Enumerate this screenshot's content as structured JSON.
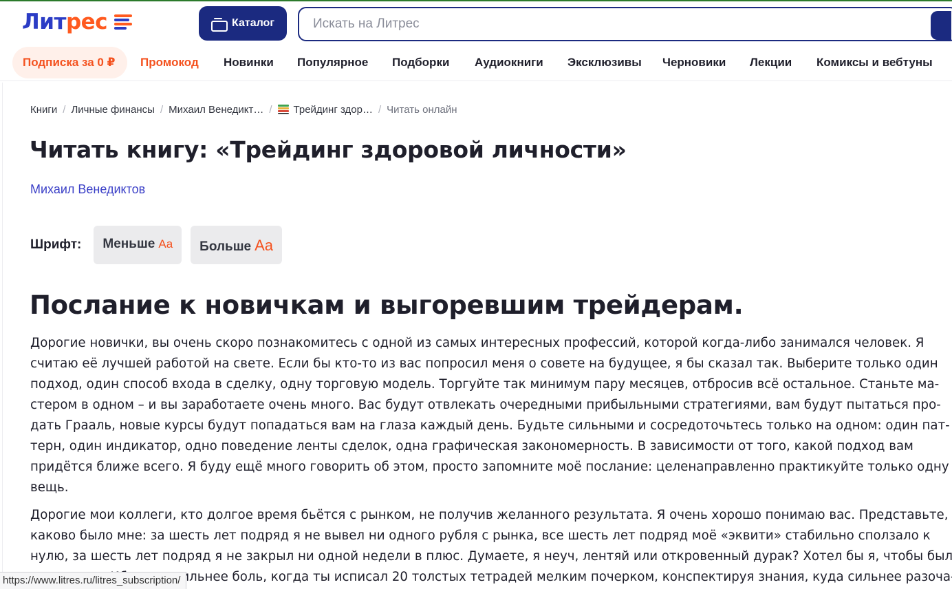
{
  "header": {
    "logo_part1": "Лит",
    "logo_part2": "рес",
    "catalog_label": "Каталог",
    "search_placeholder": "Искать на Литрес"
  },
  "nav": {
    "items": [
      "Подписка за 0 ₽",
      "Промокод",
      "Новинки",
      "Популярное",
      "Подборки",
      "Аудиокниги",
      "Эксклюзивы",
      "Черновики",
      "Лекции",
      "Комиксы и вебтуны"
    ]
  },
  "breadcrumb": {
    "items": [
      "Книги",
      "Личные финансы",
      "Михаил Венедикт…",
      "Трейдинг здор…",
      "Читать онлайн"
    ],
    "separator": "/"
  },
  "page": {
    "title": "Читать книгу: «Трейдинг здоровой личности»",
    "author": "Михаил Венедиктов"
  },
  "font_controls": {
    "label": "Шрифт:",
    "smaller": "Меньше",
    "bigger": "Больше",
    "aa": "Aa"
  },
  "chapter": {
    "title": "Послание к новичкам и выгоревшим трейдерам.",
    "paragraph1_lines": [
      "Дорогие новички, вы очень скоро познакомитесь с одной из самых интересных профессий, которой когда-либо занимался человек. Я",
      "считаю её лучшей работой на свете. Если бы кто-то из вас попросил меня о совете на будущее, я бы сказал так. Выберите только один",
      "подход, один способ входа в сделку, одну торговую модель. Торгуйте так минимум пару месяцев, отбросив всё остальное. Станьте ма-",
      "стером в одном – и вы заработаете очень много. Вас будут отвлекать очередными прибыльными стратегиями, вам будут пытаться про-",
      "дать Грааль, новые курсы будут попадаться вам на глаза каждый день. Будьте сильными и сосредоточьтесь только на одном: один пат-",
      "терн, один индикатор, одно поведение ленты сделок, одна графическая закономерность. В зависимости от того, какой подход вам",
      "придётся ближе всего. Я буду ещё много говорить об этом, просто запомните моё послание: целенаправленно практикуйте только одну",
      "вещь."
    ],
    "paragraph2_lines": [
      "Дорогие мои коллеги, кто долгое время бьётся с рынком, не получив желанного результата. Я очень хорошо понимаю вас. Представьте,",
      "каково было мне: за шесть лет подряд я не вывел ни одного рубля с рынка, все шесть лет подряд моё «эквити» стабильно сползало к",
      "нулю, за шесть лет подряд я не закрыл ни одной недели в плюс. Думаете, я неуч, лентяй или откровенный дурак? Хотел бы я, чтобы было",
      "так просто. Ибо куда сильнее боль, когда ты исписал 20 толстых тетрадей мелким почерком, конспектируя знания, куда сильнее разоча-"
    ]
  },
  "status_bar": {
    "url": "https://www.litres.ru/litres_subscription/"
  }
}
